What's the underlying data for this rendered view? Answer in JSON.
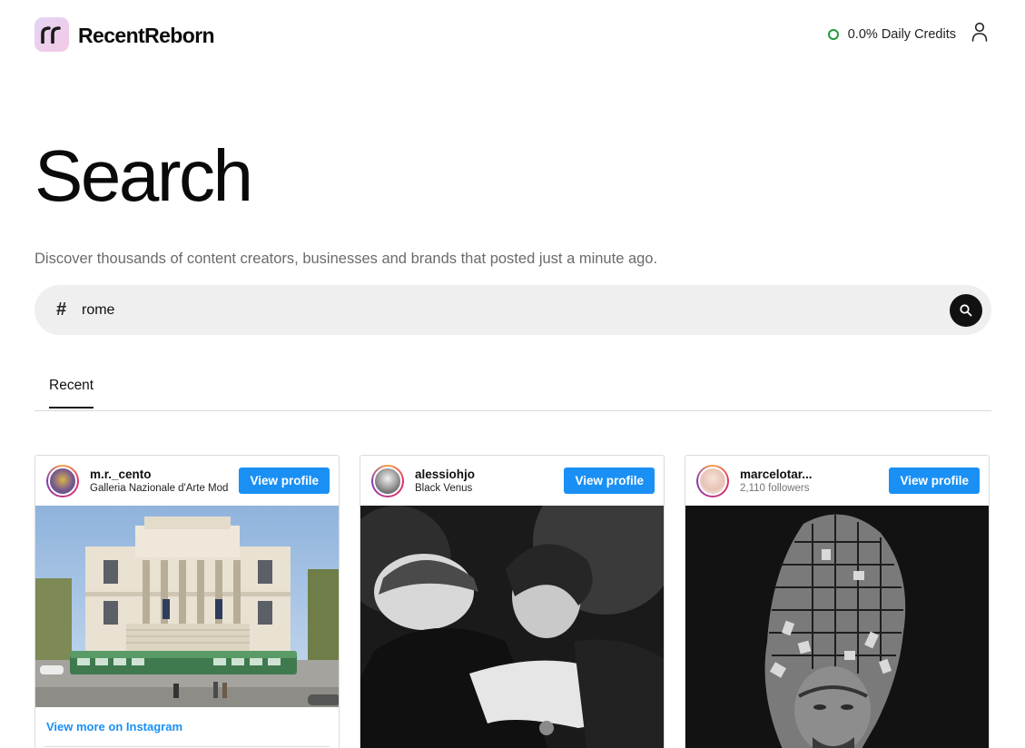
{
  "app": {
    "name": "RecentReborn"
  },
  "header": {
    "credits_label": "0.0% Daily Credits",
    "credit_status_color": "#1e9b3b"
  },
  "page": {
    "title": "Search",
    "subtitle": "Discover thousands of content creators, businesses and brands that posted just a minute ago."
  },
  "search": {
    "prefix_symbol": "#",
    "value": "rome"
  },
  "tabs": [
    {
      "label": "Recent",
      "active": true
    }
  ],
  "cards": [
    {
      "username": "m.r._cento",
      "subtitle": "Galleria Nazionale d'Arte Moderna",
      "button_label": "View profile",
      "footer_link": "View more on Instagram"
    },
    {
      "username": "alessiohjo",
      "subtitle": "Black Venus",
      "button_label": "View profile"
    },
    {
      "username": "marcelotar...",
      "subtitle": "2,110 followers",
      "button_label": "View profile"
    }
  ],
  "colors": {
    "accent": "#1a90f5",
    "text": "#111111",
    "muted": "#6b6b6b",
    "search_bg": "#efefef"
  }
}
